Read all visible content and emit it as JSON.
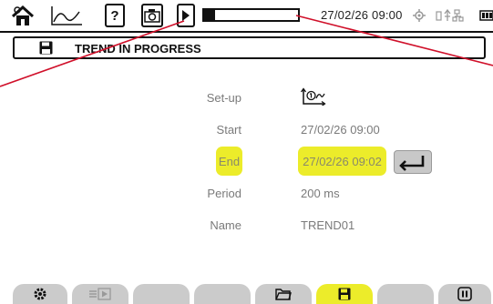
{
  "status_bar": {
    "datetime": "27/02/26 09:00",
    "recording_progress": 0.12,
    "icons": [
      "home-icon",
      "trend-icon",
      "help-icon",
      "camera-icon",
      "record-play-icon",
      "gps-icon",
      "power-usb-network-icon",
      "battery-icon"
    ]
  },
  "title_bar": {
    "icon": "save-icon",
    "title": "TREND IN PROGRESS"
  },
  "fields": {
    "setup_label": "Set-up",
    "setup_icon": "trend-config-1-icon",
    "start_label": "Start",
    "start_value": "27/02/26 09:00",
    "end_label": "End",
    "end_value": "27/02/26 09:02",
    "period_label": "Period",
    "period_value": "200 ms",
    "name_label": "Name",
    "name_value": "TREND01"
  },
  "bottom_tabs": [
    {
      "icon": "settings-icon",
      "active": false
    },
    {
      "icon": "list-play-icon",
      "active": false
    },
    {
      "icon": "",
      "active": false
    },
    {
      "icon": "",
      "active": false
    },
    {
      "icon": "folder-icon",
      "active": false
    },
    {
      "icon": "save-icon",
      "active": true
    },
    {
      "icon": "",
      "active": false
    },
    {
      "icon": "pause-icon",
      "active": false
    }
  ],
  "colors": {
    "highlight": "#ecec2a",
    "tab": "#cbcbcb",
    "callout_line": "#d0102a",
    "text_muted": "#7a7a7a"
  }
}
